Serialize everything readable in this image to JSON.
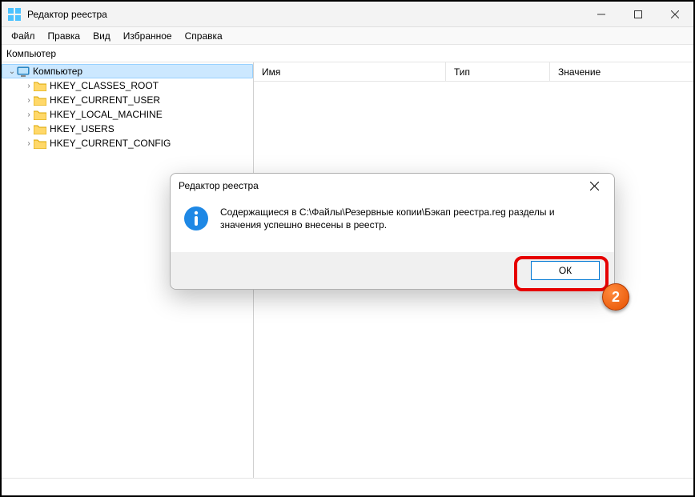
{
  "titlebar": {
    "title": "Редактор реестра"
  },
  "menu": {
    "file": "Файл",
    "edit": "Правка",
    "view": "Вид",
    "favorites": "Избранное",
    "help": "Справка"
  },
  "address": "Компьютер",
  "tree": {
    "root": "Компьютер",
    "items": [
      "HKEY_CLASSES_ROOT",
      "HKEY_CURRENT_USER",
      "HKEY_LOCAL_MACHINE",
      "HKEY_USERS",
      "HKEY_CURRENT_CONFIG"
    ]
  },
  "columns": {
    "name": "Имя",
    "type": "Тип",
    "value": "Значение"
  },
  "dialog": {
    "title": "Редактор реестра",
    "message": "Содержащиеся в C:\\Файлы\\Резервные копии\\Бэкап реестра.reg разделы и значения успешно внесены в реестр.",
    "ok": "ОК"
  },
  "badge": "2"
}
